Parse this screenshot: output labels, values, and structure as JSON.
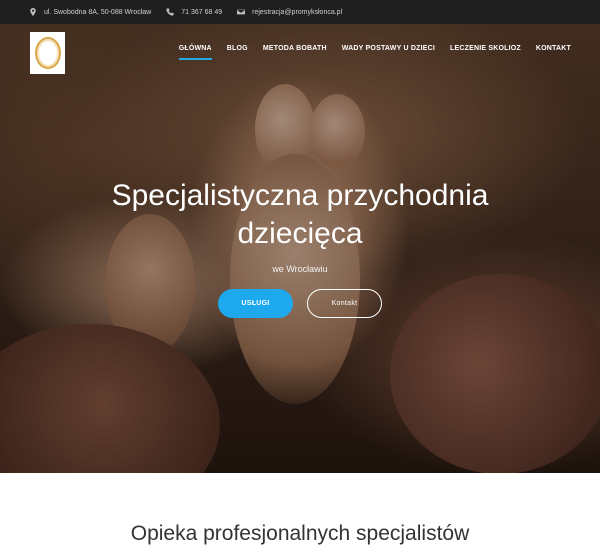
{
  "topbar": {
    "address": "ul. Swobodna 8A, 50-088 Wrocław",
    "phone": "71 367 68 49",
    "email": "rejestracja@promyksłonca.pl"
  },
  "nav": {
    "items": [
      "GŁÓWNA",
      "BLOG",
      "METODA BOBATH",
      "WADY POSTAWY U DZIECI",
      "LECZENIE SKOLIOZ",
      "KONTAKT"
    ],
    "active_index": 0
  },
  "hero": {
    "title_line1": "Specjalistyczna przychodnia",
    "title_line2": "dziecięca",
    "subtitle": "we Wrocławiu",
    "primary_button": "USŁUGI",
    "secondary_button": "Kontakt"
  },
  "section": {
    "title": "Opieka profesjonalnych specjalistów"
  },
  "colors": {
    "accent": "#1ea9ee",
    "topbar_bg": "#1f1f1f"
  }
}
